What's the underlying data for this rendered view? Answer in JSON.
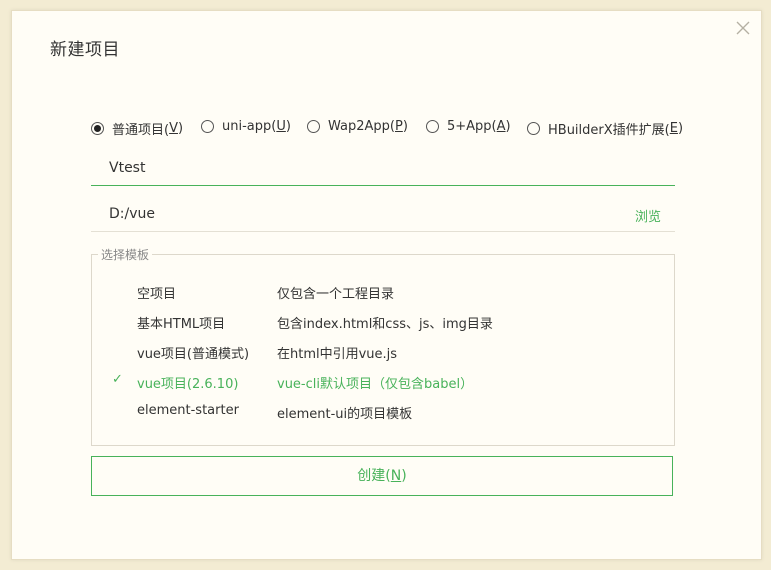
{
  "dialog": {
    "title": "新建项目",
    "close_icon": "close-icon"
  },
  "project_types": [
    {
      "label": "普通项目(",
      "key": "V",
      "suffix": ")",
      "checked": true
    },
    {
      "label": "uni-app(",
      "key": "U",
      "suffix": ")",
      "checked": false
    },
    {
      "label": "Wap2App(",
      "key": "P",
      "suffix": ")",
      "checked": false
    },
    {
      "label": "5+App(",
      "key": "A",
      "suffix": ")",
      "checked": false
    },
    {
      "label": "HBuilderX插件扩展(",
      "key": "E",
      "suffix": ")",
      "checked": false
    }
  ],
  "project_name": {
    "value": "Vtest"
  },
  "location": {
    "value": "D:/vue",
    "browse_label": "浏览"
  },
  "templates": {
    "legend": "选择模板",
    "items": [
      {
        "name": "空项目",
        "desc": "仅包含一个工程目录",
        "selected": false
      },
      {
        "name": "基本HTML项目",
        "desc": "包含index.html和css、js、img目录",
        "selected": false
      },
      {
        "name": "vue项目(普通模式)",
        "desc": "在html中引用vue.js",
        "selected": false
      },
      {
        "name": "vue项目(2.6.10)",
        "desc": "vue-cli默认项目（仅包含babel）",
        "selected": true
      },
      {
        "name": "element-starter",
        "desc": "element-ui的项目模板",
        "selected": false
      }
    ],
    "check_mark": "✓"
  },
  "create_button": {
    "label": "创建(",
    "key": "N",
    "suffix": ")"
  },
  "colors": {
    "accent": "#48b25a",
    "background": "#fffdf6"
  }
}
